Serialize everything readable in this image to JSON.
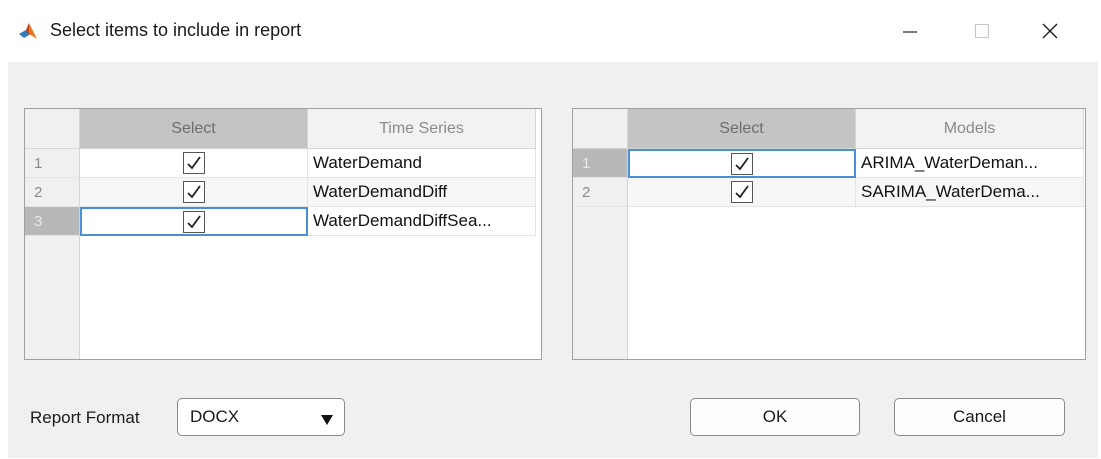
{
  "window": {
    "title": "Select items to include in report",
    "icons": {
      "app": "matlab-icon",
      "minimize": "minimize-icon",
      "maximize": "maximize-icon",
      "close": "close-icon"
    }
  },
  "time_series_table": {
    "headers": [
      "",
      "Select",
      "Time Series"
    ],
    "rows": [
      {
        "num": "1",
        "selected": true,
        "name": "WaterDemand"
      },
      {
        "num": "2",
        "selected": true,
        "name": "WaterDemandDiff"
      },
      {
        "num": "3",
        "selected": true,
        "name": "WaterDemandDiffSea..."
      }
    ]
  },
  "models_table": {
    "headers": [
      "",
      "Select",
      "Models"
    ],
    "rows": [
      {
        "num": "1",
        "selected": true,
        "name": "ARIMA_WaterDeman..."
      },
      {
        "num": "2",
        "selected": true,
        "name": "SARIMA_WaterDema..."
      }
    ]
  },
  "report_format": {
    "label": "Report Format",
    "value": "DOCX",
    "arrow": "▼"
  },
  "buttons": {
    "ok": "OK",
    "cancel": "Cancel"
  },
  "colors": {
    "focus_border": "#4a90d9",
    "select_header": "#c4c4c4",
    "client_bg": "#f0f0f0"
  }
}
